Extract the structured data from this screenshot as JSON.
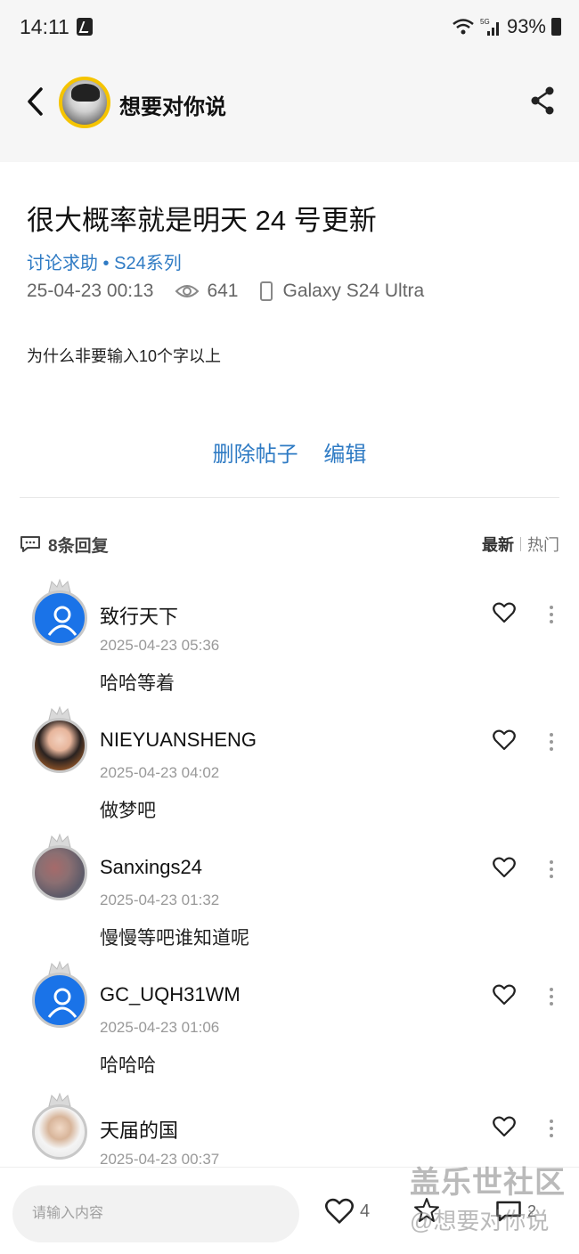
{
  "status_bar": {
    "time": "14:11",
    "battery": "93%",
    "network": "5G"
  },
  "header": {
    "author_name": "想要对你说"
  },
  "post": {
    "title": "很大概率就是明天 24 号更新",
    "category": "讨论求助 • S24系列",
    "date": "25-04-23 00:13",
    "views": "641",
    "device": "Galaxy S24 Ultra",
    "body": "为什么非要输入10个字以上",
    "actions": {
      "delete": "删除帖子",
      "edit": "编辑"
    }
  },
  "replies_header": {
    "count_label": "8条回复",
    "sort_latest": "最新",
    "sort_hot": "热门"
  },
  "replies": [
    {
      "name": "致行天下",
      "time": "2025-04-23 05:36",
      "text": "哈哈等着",
      "avatar": "default-user-icon"
    },
    {
      "name": "NIEYUANSHENG",
      "time": "2025-04-23 04:02",
      "text": "做梦吧",
      "avatar": "photo"
    },
    {
      "name": "Sanxings24",
      "time": "2025-04-23 01:32",
      "text": "慢慢等吧谁知道呢",
      "avatar": "photo"
    },
    {
      "name": "GC_UQH31WM",
      "time": "2025-04-23 01:06",
      "text": "哈哈哈",
      "avatar": "default-user-icon"
    },
    {
      "name": "天届的国",
      "time": "2025-04-23 00:37",
      "text": "",
      "avatar": "photo"
    }
  ],
  "bottom_bar": {
    "input_placeholder": "请输入内容",
    "like_count": "4",
    "comment_count": "2"
  },
  "watermark": {
    "title": "盖乐世社区",
    "sub": "@想要对你说"
  },
  "colors": {
    "accent_blue": "#2f7bc4",
    "avatar_blue": "#1a73e8",
    "avatar_ring": "#f5c400"
  }
}
